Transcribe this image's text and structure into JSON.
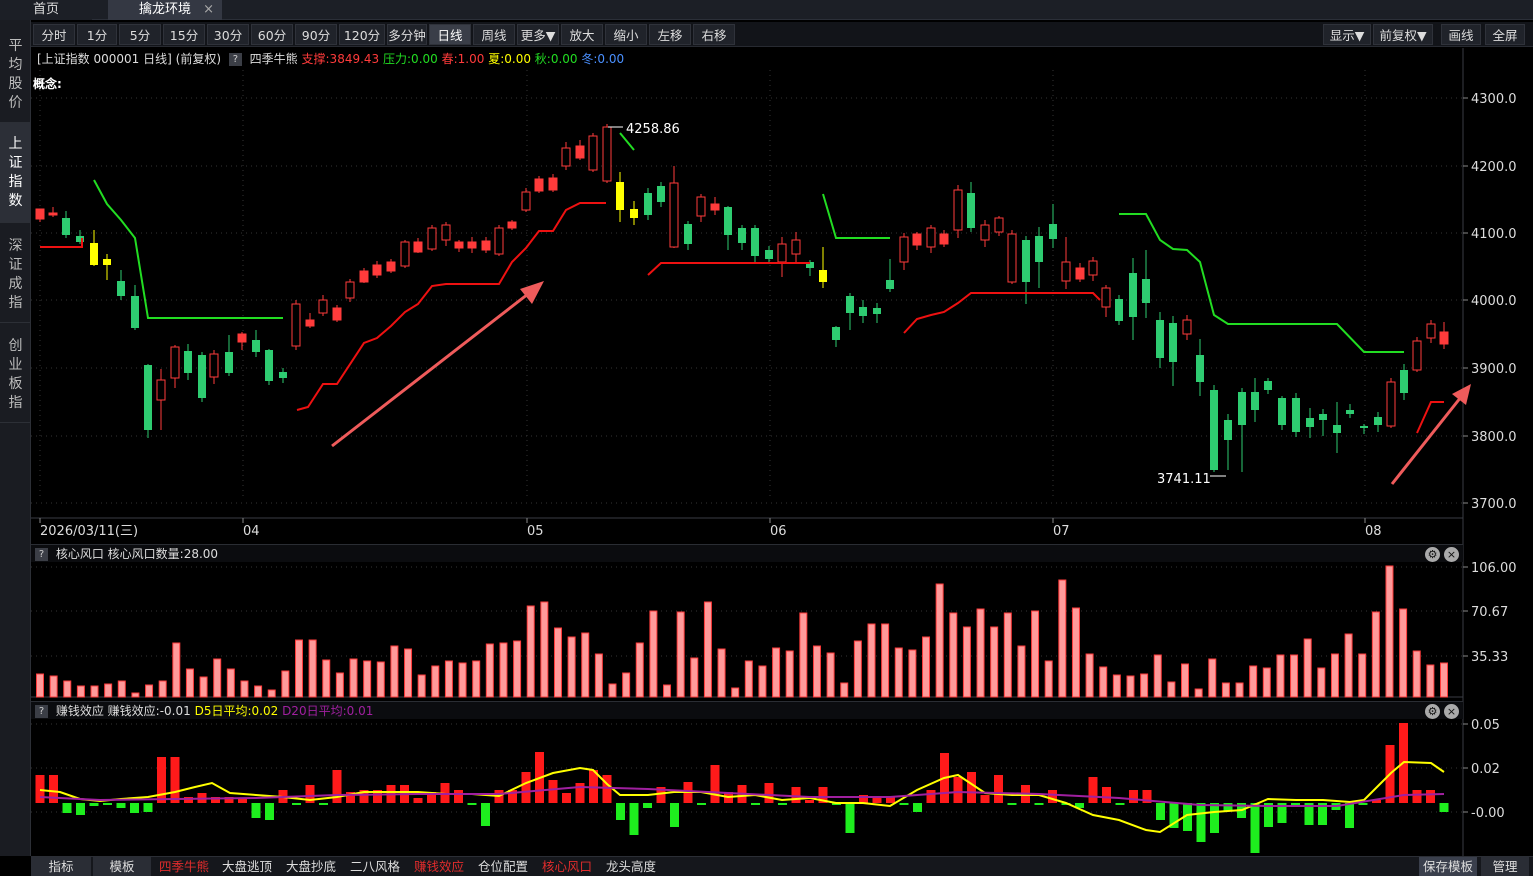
{
  "tabs": [
    {
      "label": "首页"
    },
    {
      "label": "擒龙环境",
      "close": "×"
    }
  ],
  "sidebar": {
    "items": [
      {
        "label": "平均股价"
      },
      {
        "label": "上证指数"
      },
      {
        "label": "深证成指"
      },
      {
        "label": "创业板指"
      }
    ]
  },
  "toolbar": {
    "items": [
      "分时",
      "1分",
      "5分",
      "15分",
      "30分",
      "60分",
      "90分",
      "120分",
      "多分钟",
      "日线",
      "周线",
      "更多▼",
      "放大",
      "缩小",
      "左移",
      "右移"
    ],
    "right": [
      "显示▼",
      "前复权▼",
      "画线",
      "全屏"
    ]
  },
  "info": {
    "title": "[上证指数 000001 日线]",
    "mode": "(前复权)",
    "help": "?",
    "indicator": "四季牛熊",
    "support": "支撑:3849.43",
    "pressure": "压力:0.00",
    "spring": "春:1.00",
    "summer": "夏:0.00",
    "autumn": "秋:0.00",
    "winter": "冬:0.00"
  },
  "concept": "概念:",
  "main_chart": {
    "y_ticks": [
      "4300.0",
      "4200.0",
      "4100.0",
      "4000.0",
      "3900.0",
      "3800.0",
      "3700.0"
    ],
    "x_labels": [
      "2026/03/11(三)",
      "04",
      "05",
      "06",
      "07",
      "08"
    ],
    "high_label": "4258.86",
    "low_label": "3741.11"
  },
  "panel2": {
    "help": "?",
    "title": "核心风口",
    "stat": "核心风口数量:28.00",
    "y_ticks": [
      "106.00",
      "70.67",
      "35.33"
    ]
  },
  "panel3": {
    "help": "?",
    "title": "赚钱效应",
    "stat": "赚钱效应:-0.01",
    "d5": "D5日平均:0.02",
    "d20": "D20日平均:0.01",
    "y_ticks": [
      "0.05",
      "0.02",
      "-0.00"
    ]
  },
  "bottom": {
    "items": [
      "指标",
      "模板",
      "四季牛熊",
      "大盘逃顶",
      "大盘抄底",
      "二八风格",
      "赚钱效应",
      "仓位配置",
      "核心风口",
      "龙头高度"
    ],
    "right": [
      "保存模板",
      "管理"
    ]
  },
  "colors": {
    "up": "#ff3b3b",
    "down": "#2ecc71",
    "support": "#ee1111",
    "pressure": "#22dd22",
    "yellow": "#ffff00",
    "d20": "#a020a0"
  }
}
